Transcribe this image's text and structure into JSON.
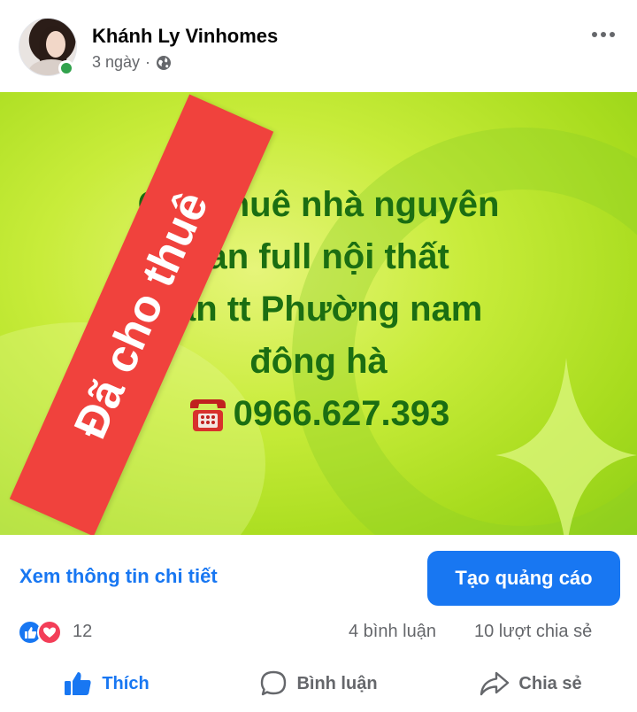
{
  "post": {
    "author": "Khánh Ly Vinhomes",
    "time": "3 ngày",
    "separator": "·",
    "privacy_icon": "globe-icon",
    "menu_icon": "more-options-icon"
  },
  "image": {
    "lines": [
      "Cho thuê nhà nguyên",
      "căn full nội thất",
      "gần tt Phường nam",
      "đông hà"
    ],
    "phone": "0966.627.393",
    "phone_icon": "telephone-icon",
    "banner": "Đã cho thuê",
    "text_color": "#1b6e12",
    "banner_color": "#f0423d"
  },
  "cta": {
    "link_label": "Xem thông tin chi tiết",
    "button_label": "Tạo quảng cáo"
  },
  "reactions": {
    "count": "12",
    "icons": [
      "like-icon",
      "love-icon"
    ],
    "comments": "4 bình luận",
    "shares": "10 lượt chia sẻ"
  },
  "actions": {
    "like": "Thích",
    "comment": "Bình luận",
    "share": "Chia sẻ"
  },
  "colors": {
    "accent": "#1877f2",
    "secondary_text": "#65676b",
    "online": "#31a24c"
  }
}
